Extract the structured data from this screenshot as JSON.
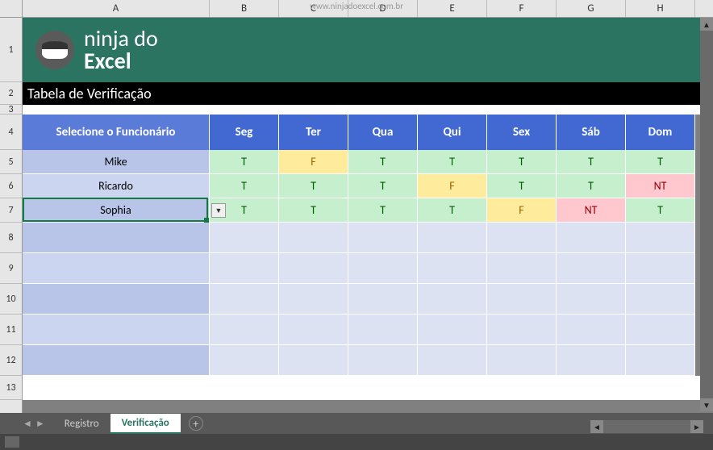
{
  "watermark": "www.ninjadoexcel.com.br",
  "columns": [
    "A",
    "B",
    "C",
    "D",
    "E",
    "F",
    "G",
    "H"
  ],
  "rows": [
    "1",
    "2",
    "3",
    "4",
    "5",
    "6",
    "7",
    "8",
    "9",
    "10",
    "11",
    "12",
    "13"
  ],
  "logo": {
    "line1": "ninja do",
    "line2": "Excel"
  },
  "title": "Tabela de Verificação",
  "headers": {
    "A": "Selecione o Funcionário",
    "B": "Seg",
    "C": "Ter",
    "D": "Qua",
    "E": "Qui",
    "F": "Sex",
    "G": "Sáb",
    "H": "Dom"
  },
  "data": [
    {
      "name": "Mike",
      "vals": [
        "T",
        "F",
        "T",
        "T",
        "T",
        "T",
        "T"
      ]
    },
    {
      "name": "Ricardo",
      "vals": [
        "T",
        "T",
        "T",
        "F",
        "T",
        "T",
        "NT"
      ]
    },
    {
      "name": "Sophia",
      "vals": [
        "T",
        "T",
        "T",
        "T",
        "F",
        "NT",
        "T"
      ]
    }
  ],
  "selected_row_index": 2,
  "tabs": {
    "inactive": "Registro",
    "active": "Verificação"
  },
  "chart_data": {
    "type": "table",
    "title": "Tabela de Verificação",
    "columns": [
      "Funcionário",
      "Seg",
      "Ter",
      "Qua",
      "Qui",
      "Sex",
      "Sáb",
      "Dom"
    ],
    "rows": [
      [
        "Mike",
        "T",
        "F",
        "T",
        "T",
        "T",
        "T",
        "T"
      ],
      [
        "Ricardo",
        "T",
        "T",
        "T",
        "F",
        "T",
        "T",
        "NT"
      ],
      [
        "Sophia",
        "T",
        "T",
        "T",
        "T",
        "F",
        "NT",
        "T"
      ]
    ],
    "legend": {
      "T": "green",
      "F": "yellow",
      "NT": "red"
    }
  }
}
